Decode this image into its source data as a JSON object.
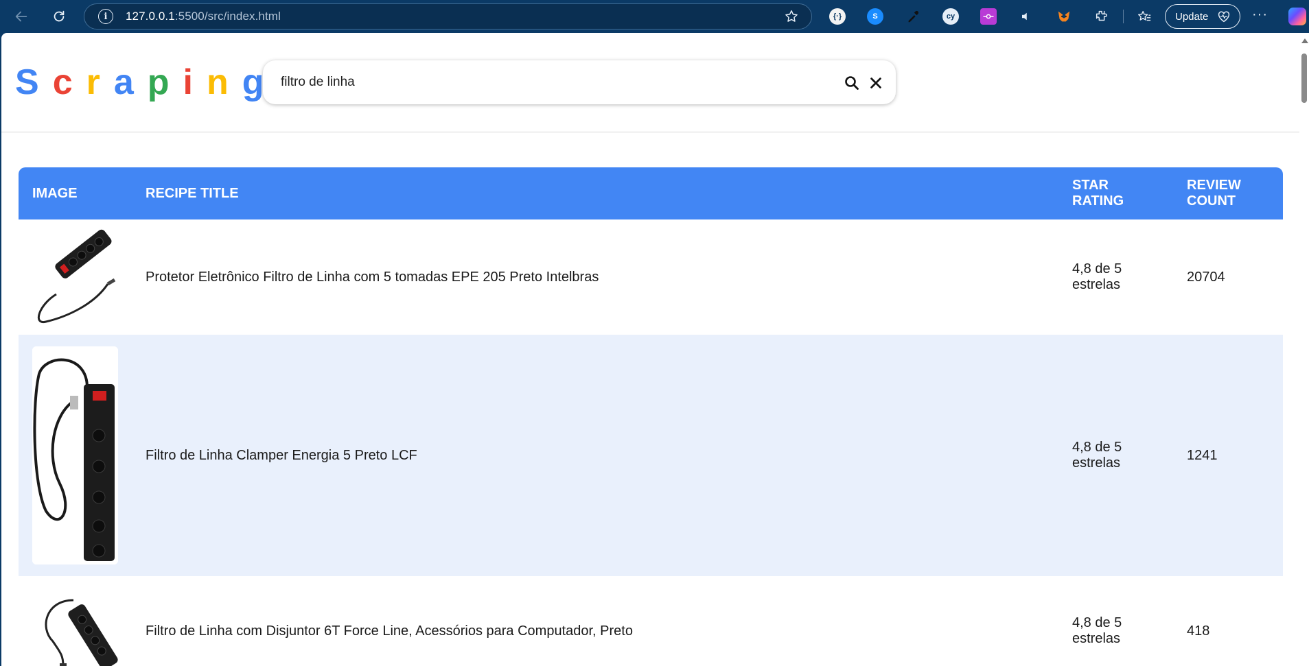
{
  "browser": {
    "url_host": "127.0.0.1",
    "url_rest": ":5500/src/index.html",
    "update_label": "Update",
    "extensions": [
      "cookie-extension-icon",
      "shazam-extension-icon",
      "color-picker-extension-icon",
      "cy-extension-icon",
      "git-extension-icon",
      "audio-extension-icon",
      "metamask-extension-icon",
      "puzzle-extensions-icon"
    ]
  },
  "app": {
    "logo_letters": [
      {
        "char": "S",
        "color": "#4285f4"
      },
      {
        "char": "c",
        "color": "#ea4335"
      },
      {
        "char": "r",
        "color": "#fbbc05"
      },
      {
        "char": "a",
        "color": "#4285f4"
      },
      {
        "char": "p",
        "color": "#34a853"
      },
      {
        "char": "i",
        "color": "#ea4335"
      },
      {
        "char": "n",
        "color": "#fbbc05"
      },
      {
        "char": "g",
        "color": "#4285f4"
      }
    ],
    "search": {
      "value": "filtro de linha"
    }
  },
  "table": {
    "headers": {
      "image": "IMAGE",
      "title": "RECIPE TITLE",
      "rating": "STAR RATING",
      "count": "REVIEW COUNT"
    },
    "rows": [
      {
        "title": "Protetor Eletrônico Filtro de Linha com 5 tomadas EPE 205 Preto Intelbras",
        "rating": "4,8 de 5 estrelas",
        "count": "20704"
      },
      {
        "title": "Filtro de Linha Clamper Energia 5 Preto LCF",
        "rating": "4,8 de 5 estrelas",
        "count": "1241"
      },
      {
        "title": "Filtro de Linha com Disjuntor 6T Force Line, Acessórios para Computador, Preto",
        "rating": "4,8 de 5 estrelas",
        "count": "418"
      }
    ]
  },
  "colors": {
    "chrome": "#0b3a66",
    "table_header": "#4286f4",
    "row_alt": "#e9f0fc"
  }
}
